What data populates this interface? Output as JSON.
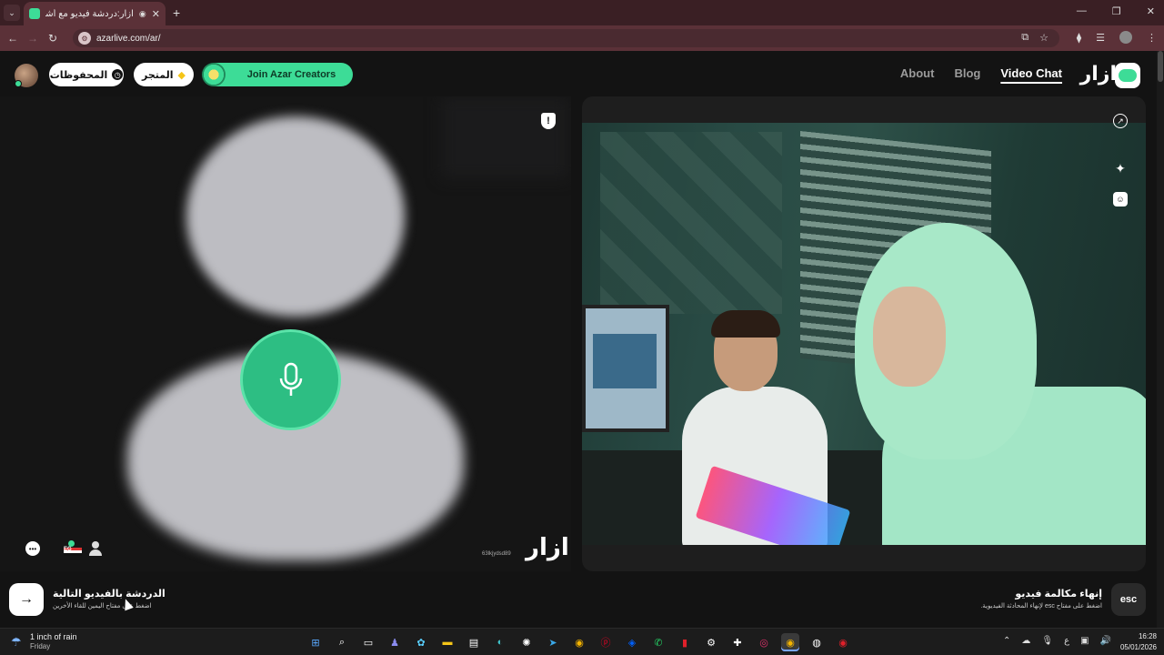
{
  "browser": {
    "tab_title": "آزار:دردشة فيديو مع أشخاص",
    "tab_audio_icon": "audio-icon",
    "url": "azarlive.com/ar/",
    "window_controls": [
      "—",
      "❐",
      "✕"
    ]
  },
  "header": {
    "saved_label": "المحفوظات",
    "store_label": "المتجر",
    "creators_label": "Join Azar Creators",
    "nav": [
      {
        "label": "About",
        "active": false
      },
      {
        "label": "Blog",
        "active": false
      },
      {
        "label": "Video Chat",
        "active": true
      }
    ],
    "logo_text": "ازار",
    "accent": "#3ddc97"
  },
  "left_panel": {
    "country_code": "EG",
    "watermark_id": "63lkjydsd89",
    "watermark_logo": "ازار"
  },
  "actions": {
    "next_title": "الدردشة بالفيديو التالية",
    "next_hint": "اضغط على مفتاح اليمين للقاء الأخرين",
    "end_title": "إنهاء مكالمة فيديو",
    "end_hint": "اضغط على مفتاح esc لإنهاء المحادثة الفيديوية.",
    "esc_label": "esc"
  },
  "taskbar": {
    "weather_main": "1 inch of rain",
    "weather_sub": "Friday",
    "time": "16:28",
    "date": "05/01/2026",
    "lang": "ع"
  }
}
